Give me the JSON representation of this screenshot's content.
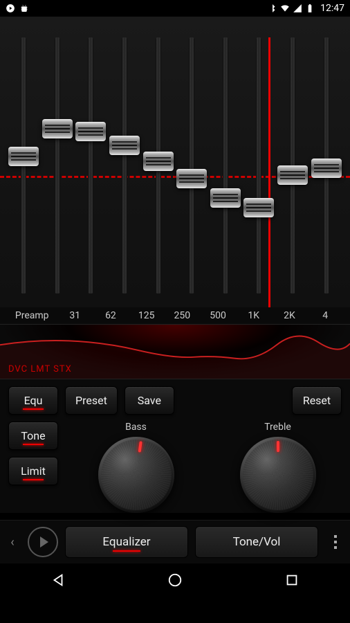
{
  "status": {
    "time": "12:47"
  },
  "eq": {
    "thumbs": [
      188,
      148,
      152,
      172,
      195,
      220,
      248,
      262,
      215,
      205
    ],
    "highlight_band_index": 7,
    "labels": [
      "Preamp",
      "31",
      "62",
      "125",
      "250",
      "500",
      "1K",
      "2K",
      "4"
    ]
  },
  "curve": {
    "text": "DVC LMT STX"
  },
  "buttons": {
    "equ": "Equ",
    "preset": "Preset",
    "save": "Save",
    "reset": "Reset",
    "tone": "Tone",
    "limit": "Limit"
  },
  "knobs": {
    "bass_label": "Bass",
    "treble_label": "Treble"
  },
  "nav": {
    "equalizer": "Equalizer",
    "tonevol": "Tone/Vol"
  }
}
